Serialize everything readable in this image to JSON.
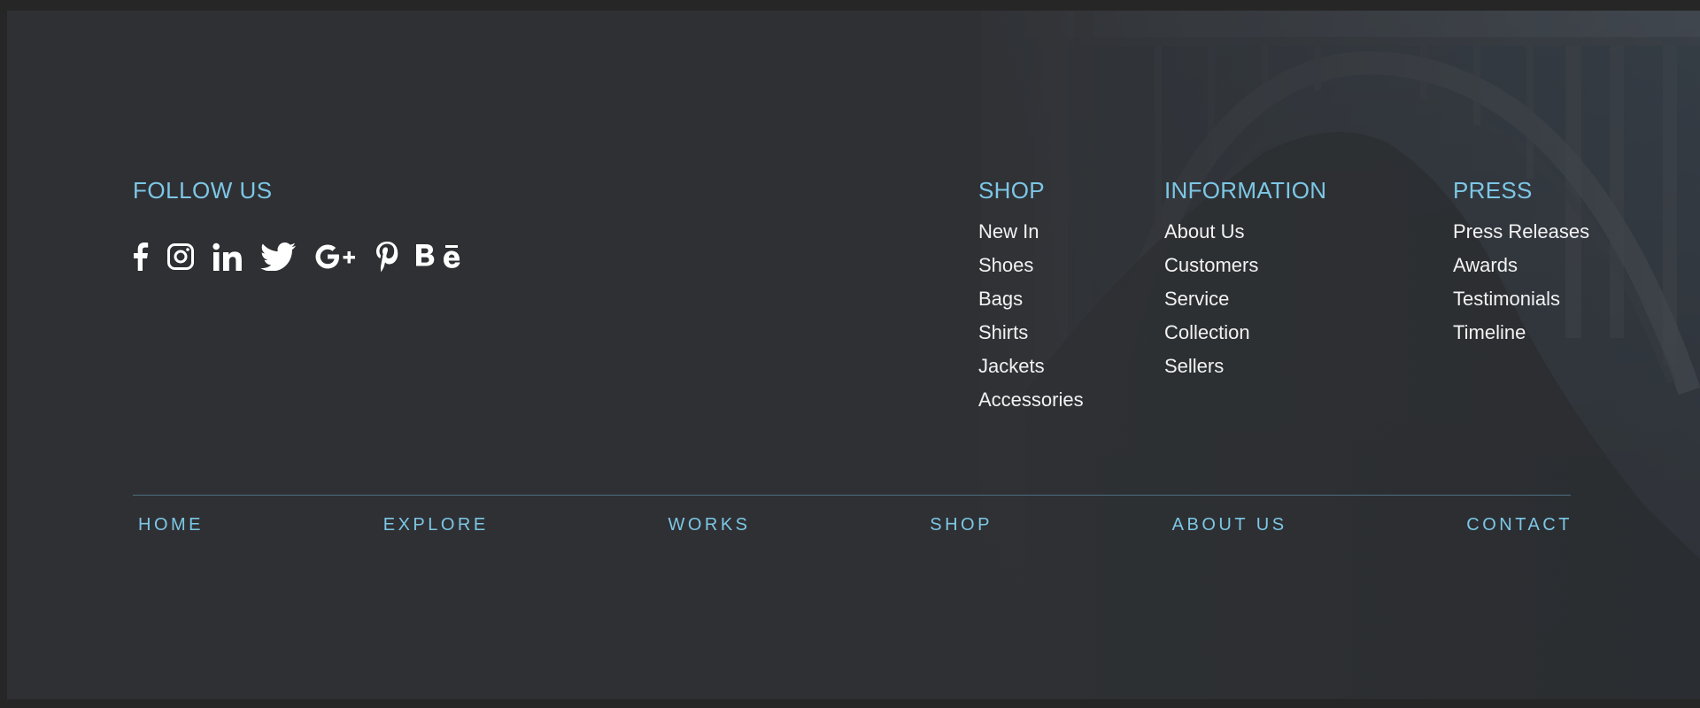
{
  "follow": {
    "heading": "FOLLOW US",
    "social": [
      {
        "icon": "facebook-icon"
      },
      {
        "icon": "instagram-icon"
      },
      {
        "icon": "linkedin-icon"
      },
      {
        "icon": "twitter-icon"
      },
      {
        "icon": "google-plus-icon"
      },
      {
        "icon": "pinterest-icon"
      },
      {
        "icon": "behance-icon"
      }
    ]
  },
  "columns": {
    "shop": {
      "heading": "SHOP",
      "items": [
        "New In",
        "Shoes",
        "Bags",
        "Shirts",
        "Jackets",
        "Accessories"
      ]
    },
    "information": {
      "heading": "INFORMATION",
      "items": [
        "About Us",
        "Customers",
        "Service",
        "Collection",
        "Sellers"
      ]
    },
    "press": {
      "heading": "PRESS",
      "items": [
        "Press Releases",
        "Awards",
        "Testimonials",
        "Timeline"
      ]
    }
  },
  "bottom_nav": [
    "HOME",
    "EXPLORE",
    "WORKS",
    "SHOP",
    "ABOUT US",
    "CONTACT"
  ],
  "colors": {
    "accent": "#7cc7e6",
    "background": "#2f3134",
    "link_text": "#f2f2f2",
    "divider": "#4c6d80"
  }
}
